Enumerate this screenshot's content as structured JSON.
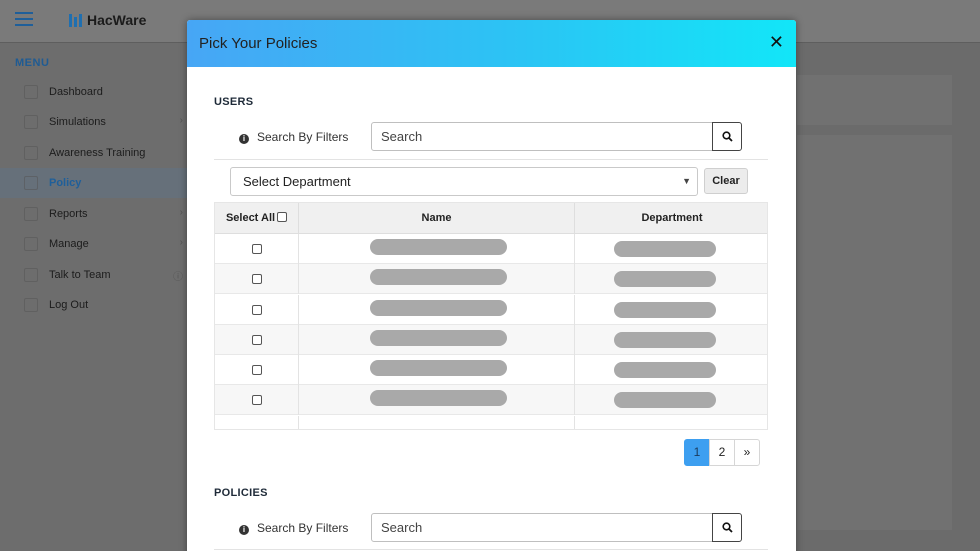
{
  "app": {
    "brand": "HacWare"
  },
  "sidebar": {
    "menu_title": "MENU",
    "items": [
      {
        "label": "Dashboard",
        "icon": "dashboard-icon"
      },
      {
        "label": "Simulations",
        "icon": "simulations-icon"
      },
      {
        "label": "Awareness Training",
        "icon": "training-icon"
      },
      {
        "label": "Policy",
        "icon": "policy-icon",
        "active": true
      },
      {
        "label": "Reports",
        "icon": "reports-icon"
      },
      {
        "label": "Manage",
        "icon": "gear-icon"
      },
      {
        "label": "Talk to Team",
        "icon": "chat-icon"
      },
      {
        "label": "Log Out",
        "icon": "logout-icon"
      }
    ]
  },
  "modal": {
    "title": "Pick Your Policies",
    "close_symbol": "✕",
    "users": {
      "section_title": "USERS",
      "filter_label": "Search By Filters",
      "search_placeholder": "Search",
      "department_select": "Select Department",
      "clear_label": "Clear",
      "columns": {
        "select_all": "Select All",
        "name": "Name",
        "department": "Department"
      },
      "row_count": 6
    },
    "pagination": {
      "pages": [
        "1",
        "2"
      ],
      "next": "»",
      "current": "1"
    },
    "policies": {
      "section_title": "POLICIES",
      "filter_label": "Search By Filters",
      "search_placeholder": "Search"
    }
  },
  "colors": {
    "header_gradient_start": "#47a6f5",
    "header_gradient_end": "#12e6f8",
    "active_page": "#3d9ff0"
  }
}
